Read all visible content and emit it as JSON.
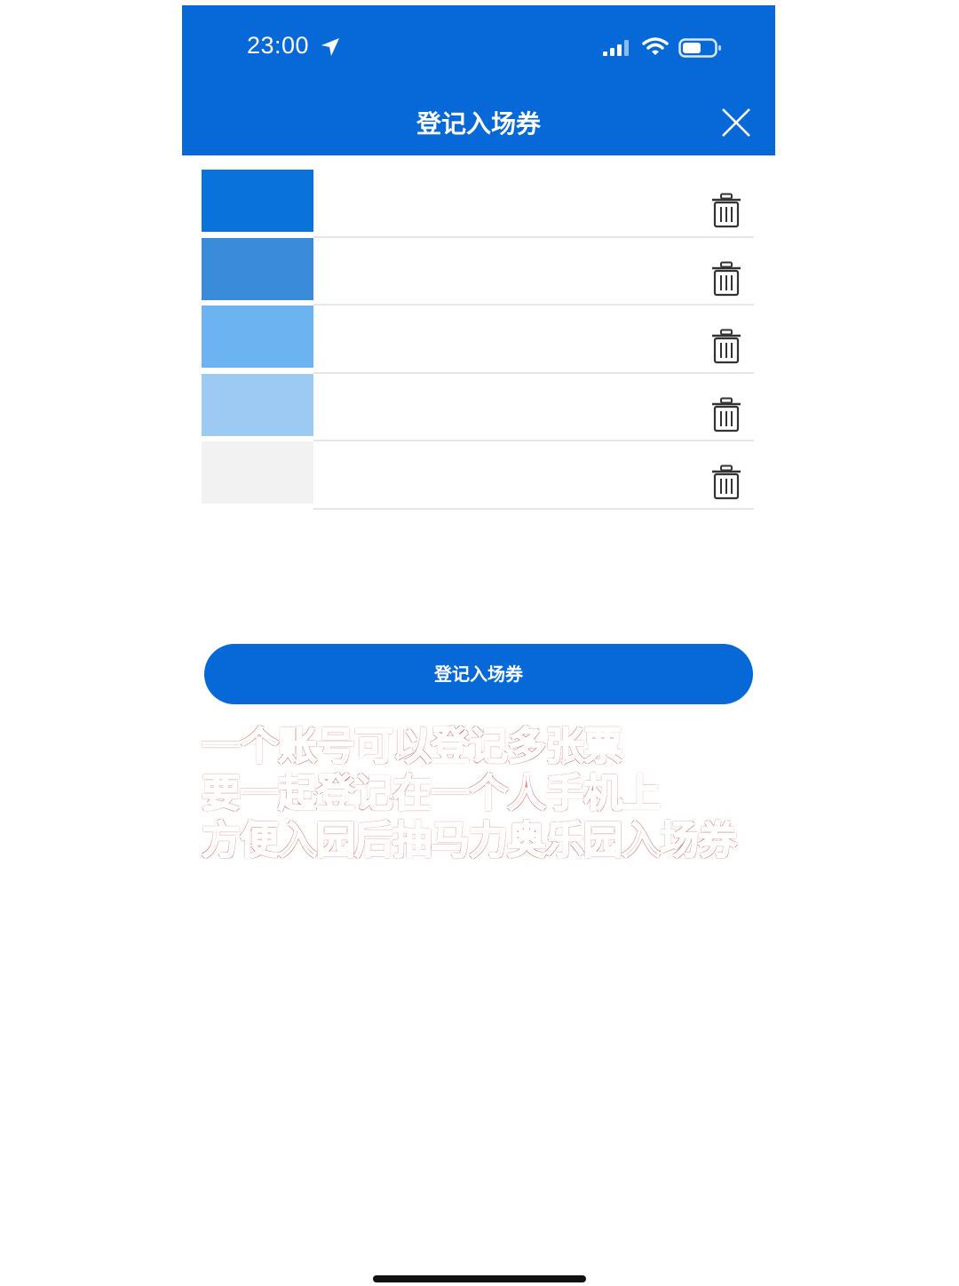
{
  "status_bar": {
    "time": "23:00",
    "icons": [
      "location-arrow-icon",
      "cellular-signal-icon",
      "wifi-icon",
      "battery-icon"
    ]
  },
  "header": {
    "title": "登记入场券",
    "close_icon": "close-icon",
    "background": "#0669d7"
  },
  "tickets": [
    {
      "color": "#0a72db"
    },
    {
      "color": "#3a8cdb"
    },
    {
      "color": "#6cb3f2"
    },
    {
      "color": "#9ccaf3"
    },
    {
      "color": "#f2f2f2"
    }
  ],
  "button": {
    "label": "登记入场券"
  },
  "caption": {
    "lines": [
      "一个账号可以登记多张票",
      "要一起登记在一个人手机上",
      "方便入园后抽马力奥乐园入场券"
    ]
  }
}
